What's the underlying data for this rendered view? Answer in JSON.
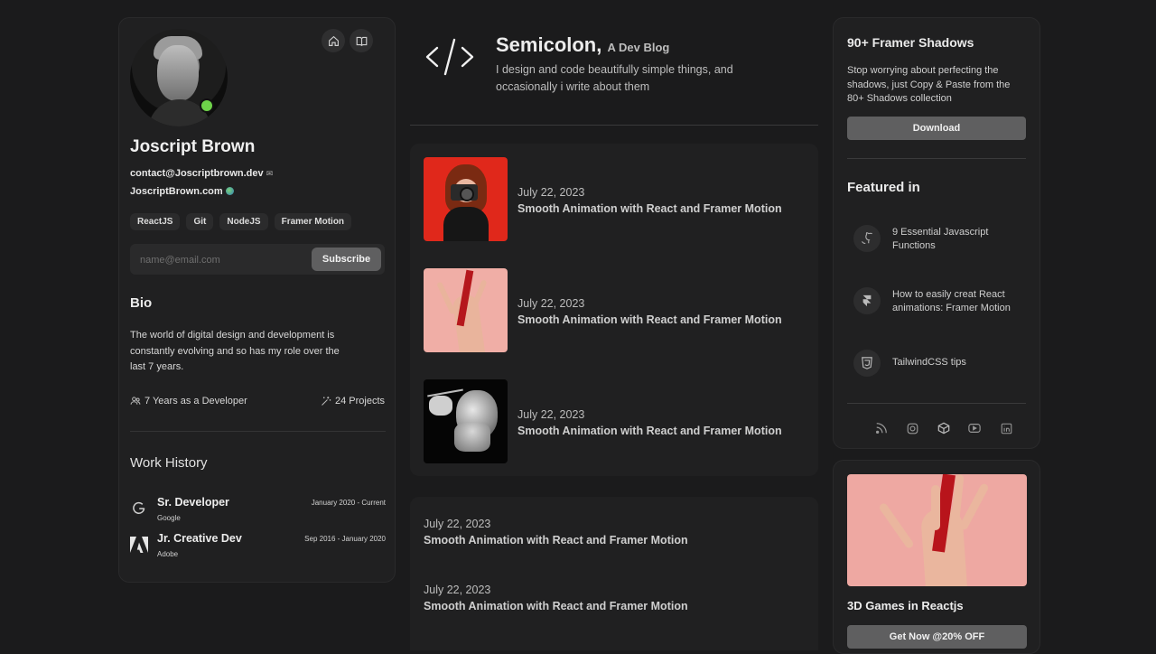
{
  "profile": {
    "name": "Joscript Brown",
    "email": "contact@Joscriptbrown.dev",
    "website": "JoscriptBrown.com",
    "tags": [
      "ReactJS",
      "Git",
      "NodeJS",
      "Framer Motion"
    ],
    "subscribe": {
      "placeholder": "name@email.com",
      "button": "Subscribe"
    },
    "bio_heading": "Bio",
    "bio_text": "The world of digital design and development is constantly evolving and so has my role over the last 7 years.",
    "stats": {
      "years": "7 Years as a Developer",
      "projects": "24 Projects"
    },
    "work_heading": "Work History",
    "jobs": [
      {
        "title": "Sr. Developer",
        "company": "Google",
        "dates": "January 2020 - Current"
      },
      {
        "title": "Jr. Creative Dev",
        "company": "Adobe",
        "dates": "Sep 2016 - January 2020"
      }
    ]
  },
  "blog": {
    "title": "Semicolon,",
    "subtitle": "A Dev Blog",
    "description": "I design and code beautifully simple things, and occasionally i write about them",
    "posts": [
      {
        "date": "July 22, 2023",
        "title": "Smooth Animation with React and Framer Motion"
      },
      {
        "date": "July 22, 2023",
        "title": "Smooth Animation with React and Framer Motion"
      },
      {
        "date": "July 22, 2023",
        "title": "Smooth Animation with React and Framer Motion"
      },
      {
        "date": "July 22, 2023",
        "title": "Smooth Animation with React and Framer Motion"
      },
      {
        "date": "July 22, 2023",
        "title": "Smooth Animation with React and Framer Motion"
      }
    ]
  },
  "sidebar": {
    "shadows_title": "90+ Framer Shadows",
    "shadows_desc": "Stop worrying about perfecting the shadows, just Copy & Paste from the 80+ Shadows collection",
    "download": "Download",
    "featured_heading": "Featured in",
    "featured": [
      {
        "icon": "github-icon",
        "text": "9 Essential Javascript Functions"
      },
      {
        "icon": "framer-icon",
        "text": "How to easily creat React animations: Framer Motion"
      },
      {
        "icon": "css3-icon",
        "text": "TailwindCSS tips"
      }
    ],
    "socials": [
      "rss-icon",
      "instagram-icon",
      "codepen-icon",
      "youtube-icon",
      "linkedin-icon"
    ],
    "promo_title": "3D Games in Reactjs",
    "promo_button": "Get Now @20% OFF"
  },
  "colors": {
    "background": "#1b1b1c",
    "card": "#202021",
    "button": "#5f5f60",
    "online": "#6ed24a"
  }
}
